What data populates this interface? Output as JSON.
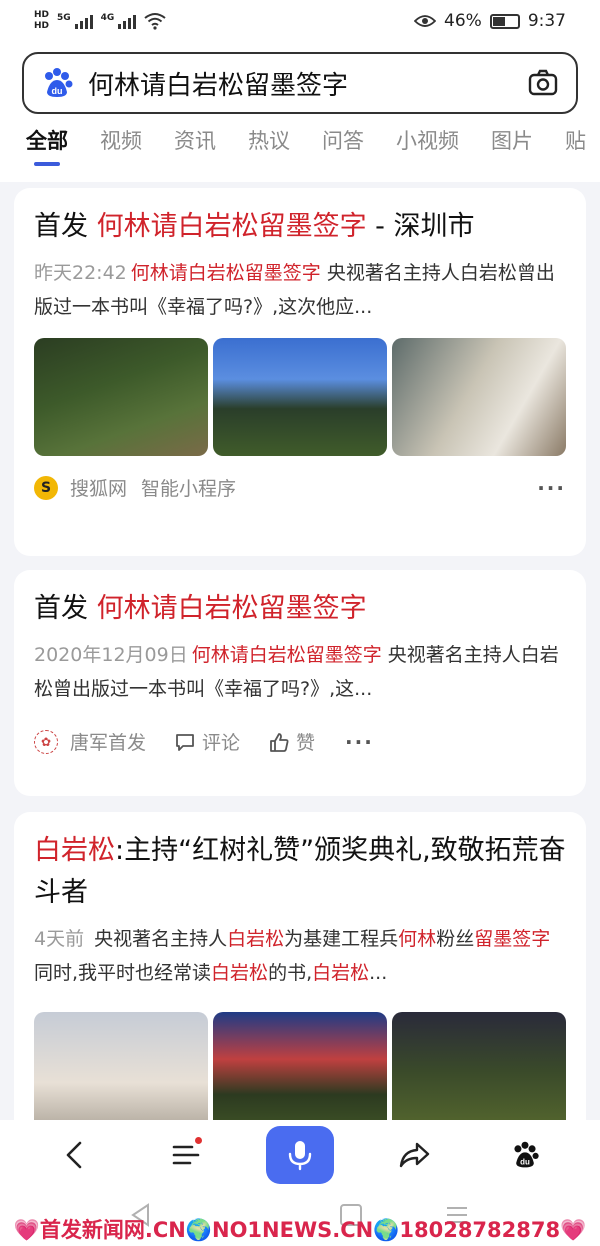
{
  "status_bar": {
    "hd1": "HD",
    "hd2": "HD",
    "sig1_tag": "5G",
    "sig2_tag": "4G",
    "battery_pct": "46%",
    "time": "9:37"
  },
  "search": {
    "query": "何林请白岩松留墨签字",
    "logo_icon": "baidu-paw-icon",
    "camera_icon": "camera-icon"
  },
  "tabs": [
    "全部",
    "视频",
    "资讯",
    "热议",
    "问答",
    "小视频",
    "图片",
    "贴"
  ],
  "results": [
    {
      "title_prefix": "首发 ",
      "title_hl": "何林请白岩松留墨签字",
      "title_suffix": " - 深圳市",
      "date": "昨天22:42",
      "snip_hl": "何林请白岩松留墨签字",
      "snip_rest": " 央视著名主持人白岩松曾出版过一本书叫《幸福了吗?》,这次他应...",
      "source": "搜狐网",
      "mini_program": "智能小程序",
      "more": "···"
    },
    {
      "title_prefix": "首发 ",
      "title_hl": "何林请白岩松留墨签字",
      "date": "2020年12月09日",
      "snip_hl": "何林请白岩松留墨签字",
      "snip_rest": " 央视著名主持人白岩松曾出版过一本书叫《幸福了吗?》,这...",
      "source": "唐军首发",
      "comment_label": "评论",
      "like_label": "赞",
      "more": "···"
    },
    {
      "title_hl": "白岩松",
      "title_suffix": ":主持“红树礼赞”颁奖典礼,致敬拓荒奋斗者",
      "date": "4天前",
      "snip_a": " 央视著名主持人",
      "snip_hl1": "白岩松",
      "snip_b": "为基建工程兵",
      "snip_hl2": "何林",
      "snip_c": "粉丝",
      "snip_hl3": "留墨签字",
      "snip_d": " 同时,我平时也经常读",
      "snip_hl4": "白岩松",
      "snip_e": "的书,",
      "snip_hl5": "白岩松",
      "snip_f": "..."
    }
  ],
  "bottom_nav": [
    "back-icon",
    "menu-icon",
    "mic-icon",
    "share-icon",
    "baidu-home-icon"
  ],
  "watermark": "💗首发新闻网.CN🌍NO1NEWS.CN🌍18028782878💗"
}
